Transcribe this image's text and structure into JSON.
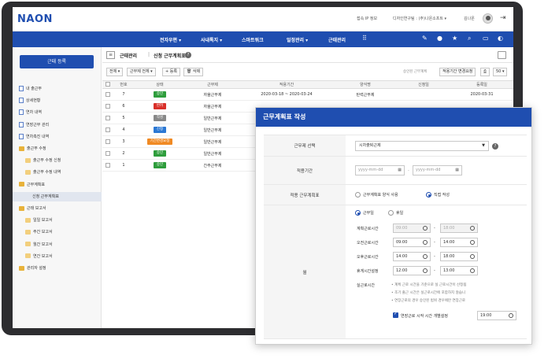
{
  "app": {
    "logo": "NAON",
    "ip_label": "접속 IP 정보",
    "dept": "디자인연구팀 : (주)나온소프트 ▾",
    "user": "김나온"
  },
  "nav": {
    "items": [
      "전자우편 ▾",
      "사내톡지 ▾",
      "스마트워크",
      "일정관리 ▾",
      "근태관리"
    ]
  },
  "sidebar": {
    "register_button": "근태 등록",
    "items": [
      {
        "label": "내 출근부",
        "icon": "doc"
      },
      {
        "label": "상세현황",
        "icon": "doc"
      },
      {
        "label": "연차 내역",
        "icon": "doc"
      },
      {
        "label": "연장근무 관리",
        "icon": "doc"
      },
      {
        "label": "연차촉진 내역",
        "icon": "doc"
      },
      {
        "label": "출근부 수정",
        "icon": "folder"
      },
      {
        "label": "출근부 수정 신청",
        "icon": "folder-o"
      },
      {
        "label": "출근부 수정 내역",
        "icon": "folder-o"
      },
      {
        "label": "근무계획표",
        "icon": "folder"
      },
      {
        "label": "신청 근무계획표",
        "icon": "none"
      },
      {
        "label": "근태 보고서",
        "icon": "folder"
      },
      {
        "label": "일일 보고서",
        "icon": "folder-o"
      },
      {
        "label": "주간 보고서",
        "icon": "folder-o"
      },
      {
        "label": "월간 보고서",
        "icon": "folder-o"
      },
      {
        "label": "연간 보고서",
        "icon": "folder-o"
      },
      {
        "label": "관리자 설정",
        "icon": "folder"
      }
    ]
  },
  "main": {
    "crumb_root": "근태관리",
    "crumb_page": "신청 근무계획표",
    "toolbar": {
      "filter_all": "전체 ▾",
      "filter_type": "근무제 전체 ▾",
      "add": "+ 등록",
      "delete": "🗑 삭제",
      "note": "승인된 근무계획",
      "change_period": "적용기간 변경요청",
      "page_size": "50 ▾"
    },
    "columns": [
      "번호",
      "상태",
      "근무제",
      "적용기간",
      "양식명",
      "신청일",
      "등록일"
    ],
    "rows": [
      {
        "no": "7",
        "status": "승인",
        "color": "#2e9d3c",
        "type": "자율근무제",
        "period": "2020-03-18 ~ 2020-03-24",
        "form": "탄력근무제",
        "applied": "",
        "registered": "2020-03-31"
      },
      {
        "no": "6",
        "status": "반려",
        "color": "#d9302a",
        "type": "자율근무제",
        "period": "",
        "form": "",
        "applied": "",
        "registered": ""
      },
      {
        "no": "5",
        "status": "작성",
        "color": "#888888",
        "type": "일반근무제",
        "period": "",
        "form": "",
        "applied": "",
        "registered": ""
      },
      {
        "no": "4",
        "status": "신청",
        "color": "#2b78d4",
        "type": "일반근무제",
        "period": "",
        "form": "",
        "applied": "",
        "registered": ""
      },
      {
        "no": "3",
        "status": "기간변경요청",
        "color": "#f08a24",
        "type": "일반근무제",
        "period": "",
        "form": "",
        "applied": "",
        "registered": ""
      },
      {
        "no": "2",
        "status": "승인",
        "color": "#2e9d3c",
        "type": "일반근무제",
        "period": "",
        "form": "",
        "applied": "",
        "registered": ""
      },
      {
        "no": "1",
        "status": "승인",
        "color": "#2e9d3c",
        "type": "간주근무제",
        "period": "",
        "form": "",
        "applied": "",
        "registered": ""
      }
    ]
  },
  "modal": {
    "title": "근무계획표 작성",
    "work_type_label": "근무제 선택",
    "work_type_value": "시차출퇴근제",
    "period_label": "적용기간",
    "date_placeholder": "yyyy-mm-dd",
    "period_sep": "-",
    "apply_label": "적용 근무계획표",
    "apply_opt1": "근무계획표 양식 사용",
    "apply_opt2": "직접 작성",
    "day_label": "월",
    "workday": "근무일",
    "holiday": "휴일",
    "times": [
      {
        "label": "계획근로시간",
        "start": "09:00",
        "end": "18:00",
        "disabled": true
      },
      {
        "label": "오전근로시간",
        "start": "09:00",
        "end": "14:00",
        "disabled": false
      },
      {
        "label": "오후근로시간",
        "start": "14:00",
        "end": "18:00",
        "disabled": false
      },
      {
        "label": "휴게시간설정",
        "start": "12:00",
        "end": "13:00",
        "disabled": false
      }
    ],
    "actual_label": "실근로시간",
    "notes": [
      "• 계획 근로 시간을 기준으로 실 근로시간이 산정됩",
      "• 조기 출근 시간은 실근로시간에 포함하지 않습니",
      "• 연장근로의 경우 승인된 범위 경우에만 연장근로"
    ],
    "overtime_label": "연장근로 시작 시간 개별설정",
    "overtime_value": "19:00"
  }
}
